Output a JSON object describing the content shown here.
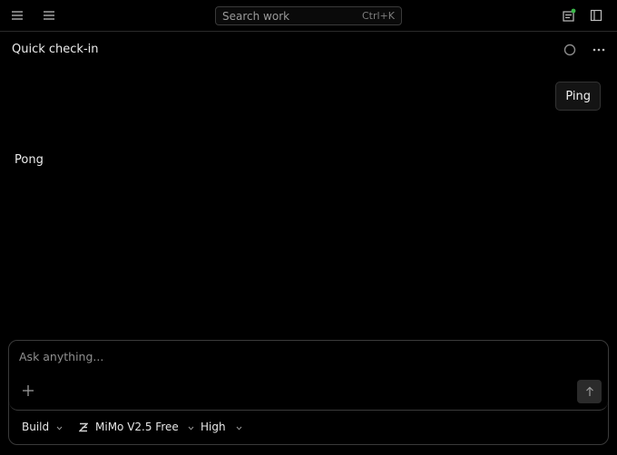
{
  "topbar": {
    "search_placeholder": "Search work",
    "search_shortcut": "Ctrl+K"
  },
  "conversation": {
    "title": "Quick check-in",
    "messages": [
      {
        "role": "user",
        "text": "Ping"
      },
      {
        "role": "assistant",
        "text": "Pong"
      }
    ]
  },
  "composer": {
    "placeholder": "Ask anything...",
    "mode": "Build",
    "model": "MiMo V2.5 Free",
    "effort": "High"
  },
  "colors": {
    "background": "#000000",
    "notification_dot": "#3bb84a"
  }
}
